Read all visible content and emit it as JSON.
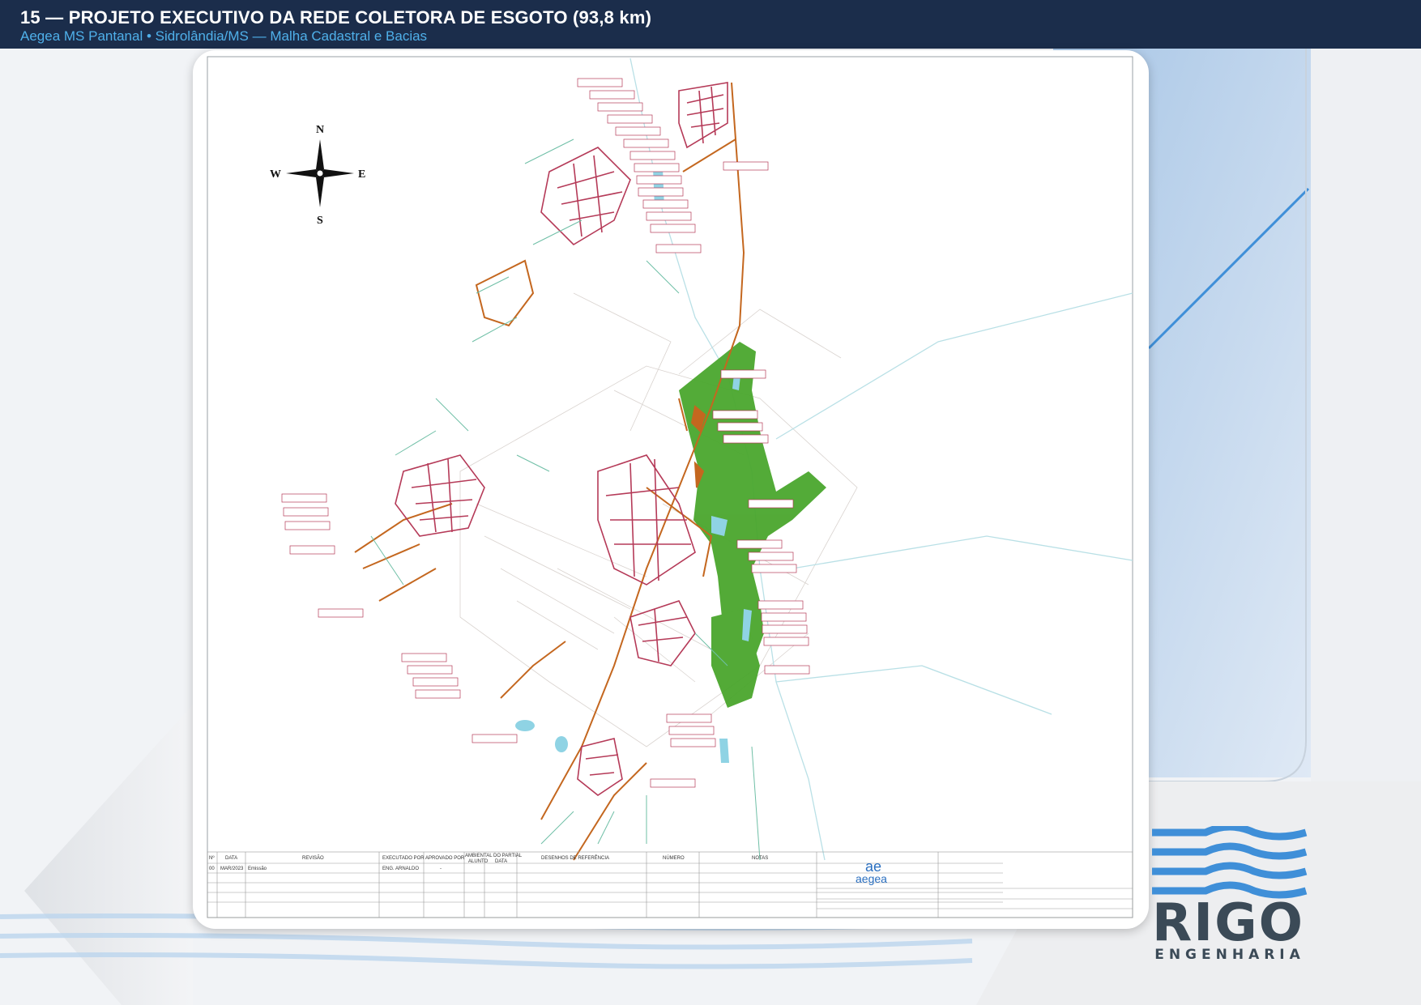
{
  "header": {
    "title": "15 — PROJETO EXECUTIVO DA REDE COLETORA DE ESGOTO (93,8 km)",
    "subtitle": "Aegea MS Pantanal • Sidrolândia/MS — Malha Cadastral e Bacias"
  },
  "compass": {
    "n": "N",
    "s": "S",
    "e": "E",
    "w": "W"
  },
  "title_block": {
    "headers": [
      "Nº",
      "DATA",
      "REVISÃO",
      "EXECUTADO POR",
      "APROVADO POR",
      "AMBIENTAL DO PARTIAL",
      "DESENHOS DE REFERÊNCIA",
      "NÚMERO",
      "NOTAS"
    ],
    "sub_headers": [
      "ALUNTO",
      "DATA"
    ],
    "row": [
      "00",
      "MAR/2023",
      "Emissão",
      "ENG. ARNALDO",
      "-"
    ]
  },
  "client_logo": {
    "mark": "ae",
    "name": "aegea"
  },
  "logo": {
    "name": "RIGO",
    "tagline": "ENGENHARIA"
  },
  "colors": {
    "header_bg": "#1b2d4b",
    "subtitle": "#4fb0ea",
    "logo_blue": "#3f8fd8",
    "logo_gray": "#3b4a57",
    "sewer_red": "#b53a58",
    "sewer_orange": "#c4671f",
    "green_area": "#4aa62d",
    "water": "#8fd3e4"
  }
}
